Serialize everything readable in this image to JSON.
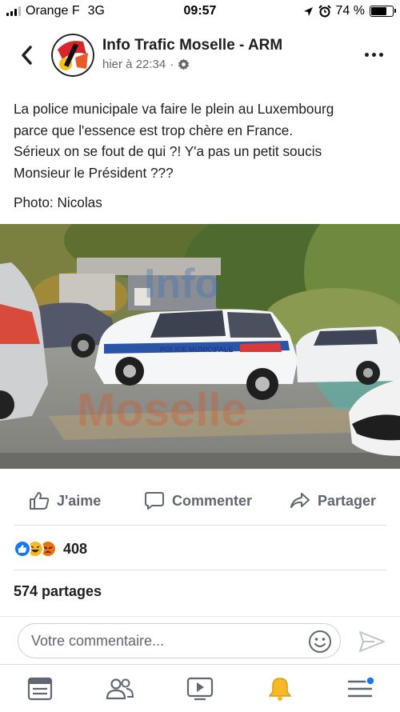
{
  "status_bar": {
    "carrier": "Orange F",
    "network": "3G",
    "time": "09:57",
    "battery": "74 %",
    "battery_level": 0.74
  },
  "post": {
    "page_name": "Info Trafic Moselle - ARM",
    "timestamp": "hier à 22:34",
    "separator": "·",
    "privacy_icon": "gear-icon",
    "text_lines": [
      "La police municipale va faire le plein au Luxembourg",
      "parce que l'essence est trop chère en France.",
      "Sérieux on se fout de qui ?! Y'a pas un petit soucis",
      "Monsieur le Président ???"
    ],
    "photo_credit": "Photo: Nicolas",
    "photo": {
      "watermark_top": "Info",
      "watermark_bottom": "Moselle",
      "car_text": "POLICE MUNICIPALE"
    }
  },
  "actions": {
    "like": "J'aime",
    "comment": "Commenter",
    "share": "Partager"
  },
  "reactions": {
    "count": "408",
    "types": [
      "like",
      "haha",
      "angry"
    ]
  },
  "shares": "574 partages",
  "comment_box": {
    "placeholder": "Votre commentaire..."
  },
  "bottom_nav": {
    "items": [
      "news-feed-icon",
      "friends-icon",
      "watch-icon",
      "notifications-icon",
      "menu-icon"
    ],
    "active_color": "#f7b928",
    "badge_color": "#1877f2"
  },
  "colors": {
    "primary_text": "#1c1e21",
    "secondary_text": "#65676b",
    "like_blue": "#1877f2",
    "angry_orange": "#e9710f"
  }
}
